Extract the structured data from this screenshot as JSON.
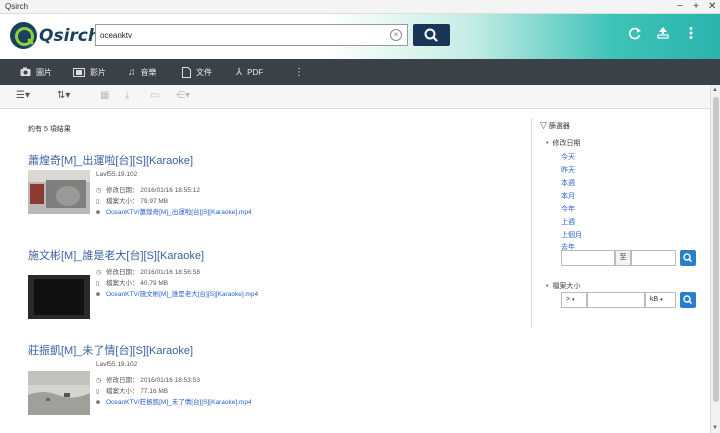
{
  "window": {
    "title": "Qsirch"
  },
  "header": {
    "logo_text": "Qsirch",
    "search_value": "oceanktv"
  },
  "toolbar": {
    "items": [
      {
        "label": "圖片",
        "icon": "camera-icon"
      },
      {
        "label": "影片",
        "icon": "film-icon"
      },
      {
        "label": "音樂",
        "icon": "music-icon"
      },
      {
        "label": "文件",
        "icon": "document-icon"
      },
      {
        "label": "PDF",
        "icon": "pdf-icon"
      }
    ]
  },
  "results": {
    "count_text": "約有 5 項結果",
    "items": [
      {
        "title": "蕭煌奇[M]_出運啦[台][S][Karaoke]",
        "encoder": "Lavf55.19.102",
        "modified": "修改日期： 2016/01/16 18:55:12",
        "size": "檔案大小： 79.97 MB",
        "path": "OceanKTV/蕭煌奇[M]_出運啦[台][S][Karaoke].mp4"
      },
      {
        "title": "施文彬[M]_誰是老大[台][S][Karaoke]",
        "encoder": "",
        "modified": "修改日期： 2016/01/16 18:56:58",
        "size": "檔案大小： 40.79 MB",
        "path": "OceanKTV/施文彬[M]_誰是老大[台][S][Karaoke].mp4"
      },
      {
        "title": "莊振凱[M]_未了情[台][S][Karaoke]",
        "encoder": "Lavf55.19.102",
        "modified": "修改日期： 2016/01/16 18:53:53",
        "size": "檔案大小： 77.16 MB",
        "path": "OceanKTV/莊振凱[M]_未了情[台][S][Karaoke].mp4"
      }
    ]
  },
  "filters": {
    "title": "篩選器",
    "date_label": "修改日期",
    "date_options": [
      "今天",
      "昨天",
      "本週",
      "本月",
      "今年",
      "上週",
      "上個月",
      "去年"
    ],
    "range_sep": "至",
    "size_label": "檔案大小",
    "size_operator": ">",
    "size_unit": "kB"
  }
}
